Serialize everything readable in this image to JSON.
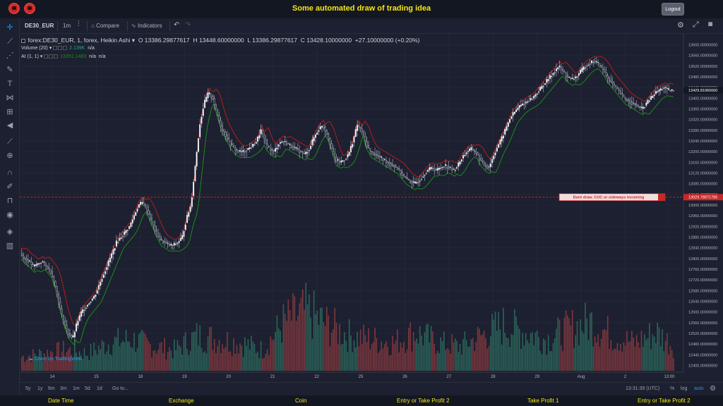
{
  "app_title": "Some automated draw of trading idea",
  "logout_label": "Logout",
  "icons": [
    "logo-icon",
    "crosshair-icon",
    "trendline-icon",
    "fib-icon",
    "brush-icon",
    "text-icon",
    "pattern-icon",
    "measure-icon",
    "back-arrow-icon",
    "ruler-icon",
    "zoom-icon",
    "magnet-icon",
    "lock-icon",
    "eye-icon",
    "layers-icon",
    "trash-icon",
    "gear-icon",
    "fullscreen-icon",
    "camera-icon"
  ],
  "toolbar": {
    "symbol": "DE30_EUR",
    "interval": "1m",
    "compare_label": "Compare",
    "indicators_label": "Indicators"
  },
  "legend": {
    "main": "forex:DE30_EUR, 1, forex, Heikin Ashi",
    "open": "O 13386.29877617",
    "high": "H 13448.60000000",
    "low": "L 13386.29877617",
    "close": "C 13428.10000000",
    "change": "+27.10000000 (+0.20%)",
    "volume_label": "Volume (20)",
    "volume_value": "2.139K",
    "volume_na": "n/a",
    "ai_label": "AI (1, 1)",
    "ai_value": "13351.1483",
    "ai_na1": "n/a",
    "ai_na2": "n/a"
  },
  "tv_logo": "Chart by TradingView",
  "annotation": {
    "text": "Dont draw. CUC or sideways incoming",
    "price": "13029.78071785"
  },
  "colors": {
    "background": "#1c2030",
    "up_volume": "#26a69a",
    "down_volume": "#ef5350",
    "upper_band": "#b71c1c",
    "lower_band": "#1b8a1b",
    "annotation_line": "#c62828",
    "title": "#f5e614"
  },
  "chart_data": {
    "type": "candlestick",
    "x_tick_labels": [
      "14",
      "15",
      "18",
      "19",
      "20",
      "21",
      "22",
      "25",
      "26",
      "27",
      "28",
      "29",
      "Aug",
      "2",
      "13:00"
    ],
    "y_tick_labels": [
      "13600.00000000",
      "13560.00000000",
      "13520.00000000",
      "13480.00000000",
      "13440.00000000",
      "13400.00000000",
      "13360.00000000",
      "13320.00000000",
      "13280.00000000",
      "13240.00000000",
      "13200.00000000",
      "13160.00000000",
      "13120.00000000",
      "13080.00000000",
      "13040.00000000",
      "13000.00000000",
      "12960.00000000",
      "12920.00000000",
      "12880.00000000",
      "12840.00000000",
      "12800.00000000",
      "12760.00000000",
      "12720.00000000",
      "12680.00000000",
      "12640.00000000",
      "12600.00000000",
      "12560.00000000",
      "12520.00000000",
      "12480.00000000",
      "12440.00000000",
      "12400.00000000"
    ],
    "ylim": [
      12380,
      13620
    ],
    "last_price": "13429.81060000",
    "last_value": 13429.8,
    "annotation_value": 13029.8,
    "price_path": [
      [
        0,
        12820
      ],
      [
        6,
        12800
      ],
      [
        12,
        12790
      ],
      [
        18,
        12770
      ],
      [
        24,
        12780
      ],
      [
        30,
        12790
      ],
      [
        36,
        12770
      ],
      [
        42,
        12750
      ],
      [
        48,
        12700
      ],
      [
        54,
        12620
      ],
      [
        60,
        12560
      ],
      [
        66,
        12520
      ],
      [
        72,
        12500
      ],
      [
        78,
        12560
      ],
      [
        84,
        12600
      ],
      [
        90,
        12620
      ],
      [
        96,
        12640
      ],
      [
        102,
        12660
      ],
      [
        108,
        12700
      ],
      [
        114,
        12740
      ],
      [
        120,
        12780
      ],
      [
        126,
        12820
      ],
      [
        132,
        12860
      ],
      [
        138,
        12880
      ],
      [
        144,
        12900
      ],
      [
        150,
        12920
      ],
      [
        156,
        12960
      ],
      [
        162,
        13000
      ],
      [
        168,
        13010
      ],
      [
        174,
        12980
      ],
      [
        180,
        12940
      ],
      [
        186,
        12900
      ],
      [
        192,
        12870
      ],
      [
        198,
        12860
      ],
      [
        204,
        12850
      ],
      [
        210,
        12850
      ],
      [
        216,
        12860
      ],
      [
        222,
        12880
      ],
      [
        228,
        12950
      ],
      [
        234,
        13000
      ],
      [
        240,
        13150
      ],
      [
        246,
        13300
      ],
      [
        252,
        13380
      ],
      [
        258,
        13420
      ],
      [
        264,
        13400
      ],
      [
        270,
        13340
      ],
      [
        276,
        13290
      ],
      [
        282,
        13260
      ],
      [
        288,
        13230
      ],
      [
        294,
        13210
      ],
      [
        300,
        13200
      ],
      [
        306,
        13200
      ],
      [
        312,
        13210
      ],
      [
        318,
        13220
      ],
      [
        324,
        13240
      ],
      [
        330,
        13280
      ],
      [
        336,
        13230
      ],
      [
        342,
        13210
      ],
      [
        348,
        13200
      ],
      [
        354,
        13230
      ],
      [
        360,
        13240
      ],
      [
        366,
        13230
      ],
      [
        372,
        13220
      ],
      [
        378,
        13210
      ],
      [
        384,
        13200
      ],
      [
        390,
        13190
      ],
      [
        396,
        13210
      ],
      [
        402,
        13250
      ],
      [
        408,
        13280
      ],
      [
        414,
        13300
      ],
      [
        420,
        13270
      ],
      [
        426,
        13220
      ],
      [
        432,
        13170
      ],
      [
        438,
        13160
      ],
      [
        444,
        13170
      ],
      [
        450,
        13190
      ],
      [
        456,
        13240
      ],
      [
        462,
        13300
      ],
      [
        468,
        13280
      ],
      [
        474,
        13230
      ],
      [
        480,
        13200
      ],
      [
        486,
        13190
      ],
      [
        492,
        13180
      ],
      [
        498,
        13170
      ],
      [
        504,
        13160
      ],
      [
        510,
        13150
      ],
      [
        516,
        13140
      ],
      [
        522,
        13120
      ],
      [
        528,
        13100
      ],
      [
        534,
        13090
      ],
      [
        540,
        13080
      ],
      [
        546,
        13090
      ],
      [
        552,
        13110
      ],
      [
        558,
        13130
      ],
      [
        564,
        13140
      ],
      [
        570,
        13130
      ],
      [
        576,
        13140
      ],
      [
        582,
        13150
      ],
      [
        588,
        13140
      ],
      [
        594,
        13130
      ],
      [
        600,
        13150
      ],
      [
        606,
        13180
      ],
      [
        612,
        13200
      ],
      [
        618,
        13210
      ],
      [
        624,
        13200
      ],
      [
        630,
        13170
      ],
      [
        636,
        13150
      ],
      [
        642,
        13140
      ],
      [
        648,
        13180
      ],
      [
        654,
        13220
      ],
      [
        660,
        13250
      ],
      [
        666,
        13290
      ],
      [
        672,
        13330
      ],
      [
        678,
        13350
      ],
      [
        684,
        13370
      ],
      [
        690,
        13380
      ],
      [
        696,
        13390
      ],
      [
        702,
        13400
      ],
      [
        708,
        13420
      ],
      [
        714,
        13440
      ],
      [
        720,
        13460
      ],
      [
        726,
        13480
      ],
      [
        732,
        13500
      ],
      [
        738,
        13520
      ],
      [
        744,
        13500
      ],
      [
        750,
        13480
      ],
      [
        756,
        13470
      ],
      [
        762,
        13480
      ],
      [
        768,
        13500
      ],
      [
        774,
        13520
      ],
      [
        780,
        13530
      ],
      [
        786,
        13540
      ],
      [
        792,
        13530
      ],
      [
        798,
        13510
      ],
      [
        804,
        13480
      ],
      [
        810,
        13460
      ],
      [
        816,
        13440
      ],
      [
        822,
        13420
      ],
      [
        828,
        13400
      ],
      [
        834,
        13390
      ],
      [
        840,
        13380
      ],
      [
        846,
        13370
      ],
      [
        852,
        13360
      ],
      [
        858,
        13380
      ],
      [
        864,
        13400
      ],
      [
        870,
        13420
      ],
      [
        876,
        13430
      ],
      [
        882,
        13440
      ],
      [
        888,
        13430
      ],
      [
        894,
        13428
      ]
    ],
    "volume_max": 100,
    "volume_profile": [
      [
        0,
        20
      ],
      [
        30,
        25
      ],
      [
        60,
        30
      ],
      [
        90,
        25
      ],
      [
        120,
        40
      ],
      [
        150,
        45
      ],
      [
        180,
        35
      ],
      [
        210,
        30
      ],
      [
        240,
        50
      ],
      [
        270,
        45
      ],
      [
        300,
        40
      ],
      [
        330,
        30
      ],
      [
        360,
        70
      ],
      [
        390,
        85
      ],
      [
        420,
        65
      ],
      [
        450,
        50
      ],
      [
        480,
        45
      ],
      [
        510,
        40
      ],
      [
        540,
        55
      ],
      [
        570,
        40
      ],
      [
        600,
        35
      ],
      [
        630,
        50
      ],
      [
        660,
        65
      ],
      [
        690,
        55
      ],
      [
        720,
        45
      ],
      [
        750,
        60
      ],
      [
        780,
        70
      ],
      [
        810,
        50
      ],
      [
        840,
        40
      ],
      [
        870,
        55
      ],
      [
        894,
        35
      ]
    ]
  },
  "range_bar": {
    "ranges": [
      "5y",
      "1y",
      "6m",
      "3m",
      "1m",
      "5d",
      "1d"
    ],
    "goto": "Go to...",
    "time": "13:31:39 (UTC)",
    "percent": "%",
    "log": "log",
    "auto": "auto"
  },
  "footer": [
    "Date Time",
    "Exchange",
    "Coin",
    "Entry or Take Profit 2",
    "Take Profit 1",
    "Entry or Take Profit 2"
  ]
}
